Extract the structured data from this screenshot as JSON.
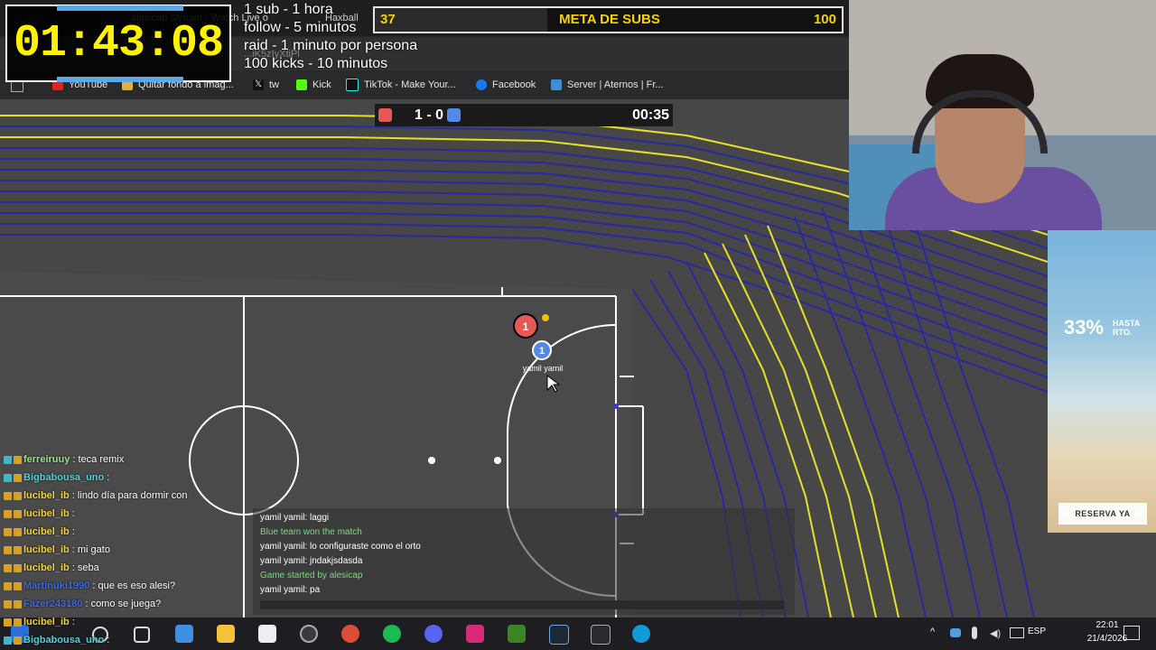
{
  "browser": {
    "tabs": [
      "alesicap Stream - Watch Live o",
      "Haxball"
    ],
    "url_fragment": "...iK5zIyXtiPl",
    "bookmarks": [
      {
        "label": "YouTube",
        "icon": "youtube-icon",
        "color": "#e62117"
      },
      {
        "label": "Quitar fondo a imag...",
        "icon": "image-icon",
        "color": "#e0b23a"
      },
      {
        "label": "tw",
        "icon": "x-icon",
        "color": "#ffffff"
      },
      {
        "label": "Kick",
        "icon": "kick-icon",
        "color": "#53fc18"
      },
      {
        "label": "TikTok - Make Your...",
        "icon": "tiktok-icon",
        "color": "#ffffff"
      },
      {
        "label": "Facebook",
        "icon": "facebook-icon",
        "color": "#1877f2"
      },
      {
        "label": "Server | Aternos | Fr...",
        "icon": "aternos-icon",
        "color": "#3a8fd8"
      }
    ]
  },
  "overlay": {
    "timer": "01:43:08",
    "rules": [
      "1 sub - 1 hora",
      "follow - 5 minutos",
      "raid - 1 minuto por persona",
      "100 kicks - 10 minutos"
    ],
    "goal": {
      "current": "37",
      "title": "META DE SUBS",
      "max": "100",
      "progress": 0.37
    }
  },
  "game": {
    "score": "1 - 0",
    "time": "00:35",
    "red_color": "#e55a57",
    "blue_color": "#5689e5",
    "red_player_number": "1",
    "blue_player_number": "1",
    "blue_player_name": "yamil yamil",
    "chat": [
      {
        "text": "yamil yamil: laggi",
        "color": "#ffffff"
      },
      {
        "text": "Blue team won the match",
        "color": "#7dd87d"
      },
      {
        "text": "yamil yamil: lo configuraste como el orto",
        "color": "#ffffff"
      },
      {
        "text": "yamil yamil: jndakjsdasda",
        "color": "#ffffff"
      },
      {
        "text": "Game started by alesicap",
        "color": "#7dd87d"
      },
      {
        "text": "yamil yamil: pa",
        "color": "#ffffff"
      }
    ]
  },
  "stream_chat": [
    {
      "user": "ferreiruuy",
      "message": ": teca remix",
      "user_class": "u-green"
    },
    {
      "user": "Bigbabousa_uno",
      "message": ":",
      "user_class": "u-cyan"
    },
    {
      "user": "lucibel_ib",
      "message": ": lindo día para dormir con",
      "user_class": "u-yellow"
    },
    {
      "user": "lucibel_ib",
      "message": ":",
      "user_class": "u-yellow"
    },
    {
      "user": "lucibel_ib",
      "message": ":",
      "user_class": "u-yellow"
    },
    {
      "user": "lucibel_ib",
      "message": ": mi gato",
      "user_class": "u-yellow"
    },
    {
      "user": "lucibel_ib",
      "message": ": seba",
      "user_class": "u-yellow"
    },
    {
      "user": "Martinuki1990",
      "message": ": que es eso alesi?",
      "user_class": "u-blue"
    },
    {
      "user": "Fazer243180",
      "message": ": como se juega?",
      "user_class": "u-blue"
    },
    {
      "user": "lucibel_ib",
      "message": ":",
      "user_class": "u-yellow"
    },
    {
      "user": "Bigbabousa_uno",
      "message": ":",
      "user_class": "u-cyan"
    }
  ],
  "ad": {
    "discount": "33%",
    "hasta": "HASTA",
    "hasta2": "RTO.",
    "button": "RESERVA YA"
  },
  "taskbar": {
    "time": "22:01",
    "date": "21/4/2026",
    "language": "ESP"
  }
}
